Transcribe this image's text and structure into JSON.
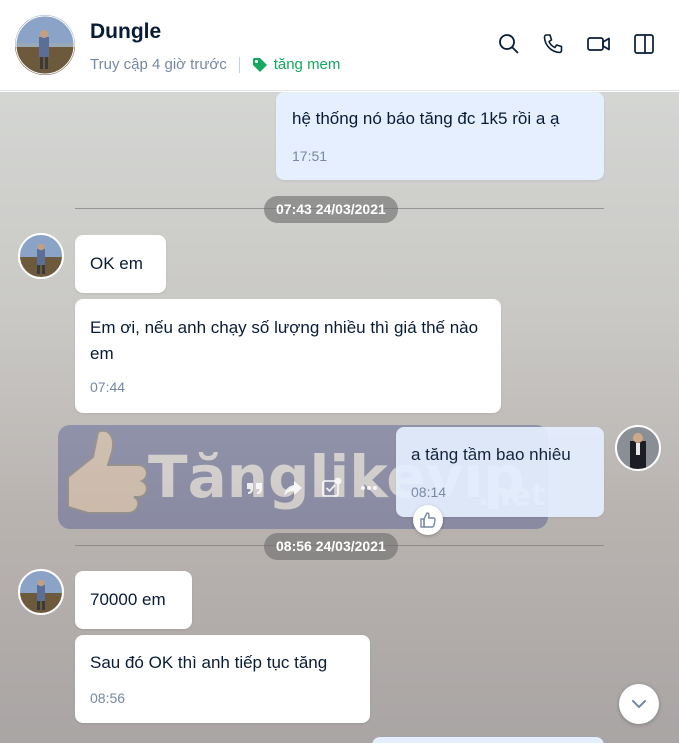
{
  "header": {
    "name": "Dungle",
    "last_seen": "Truy cập 4 giờ trước",
    "tag_label": "tăng mem",
    "tag_color": "#15a85f",
    "actions": [
      "search-icon",
      "phone-icon",
      "video-icon",
      "sidebar-toggle-icon"
    ]
  },
  "messages": [
    {
      "from": "me",
      "text": "hệ thống nó báo tăng đc 1k5 rồi a ạ",
      "time": "17:51"
    },
    {
      "divider": "07:43 24/03/2021"
    },
    {
      "from": "contact",
      "text": "OK em"
    },
    {
      "from": "contact",
      "text": "Em ơi, nếu anh chạy số lượng nhiều thì giá thế nào em",
      "time": "07:44"
    },
    {
      "from": "me",
      "text": "a tăng tầm bao nhiêu",
      "time": "08:14"
    },
    {
      "divider": "08:56 24/03/2021"
    },
    {
      "from": "contact",
      "text": "70000 em"
    },
    {
      "from": "contact",
      "text": "Sau đó OK thì anh tiếp tục tăng",
      "time": "08:56"
    }
  ],
  "message_actions": [
    "quote-icon",
    "forward-icon",
    "select-icon",
    "more-icon"
  ],
  "watermark": {
    "text": "Tănglikevip",
    "suffix": ".net"
  },
  "colors": {
    "me_bubble": "#e5efff",
    "contact_bubble": "#ffffff",
    "accent": "#0068ff"
  }
}
